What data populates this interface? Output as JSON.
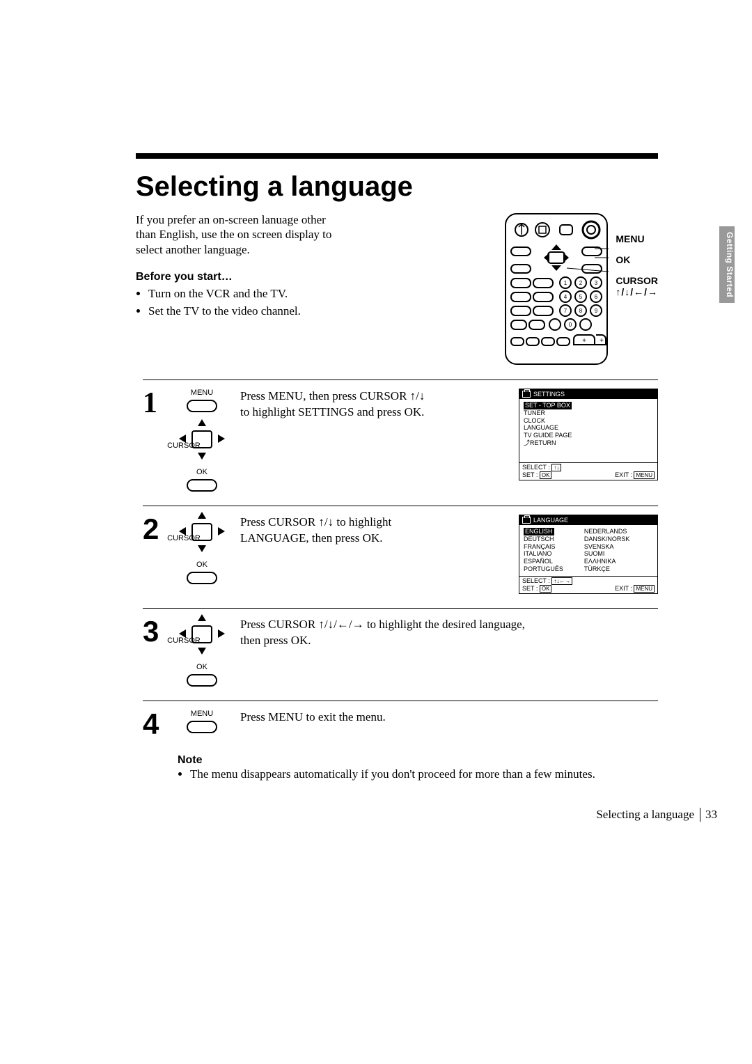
{
  "title": "Selecting a language",
  "intro_paragraph": "If you prefer an on-screen lanuage other than English, use the on screen display to select another language.",
  "before_you_start_heading": "Before you start…",
  "before_you_start_items": [
    "Turn on the VCR and the TV.",
    "Set the TV to the video channel."
  ],
  "side_tab": "Getting Started",
  "remote_labels": {
    "menu": "MENU",
    "ok": "OK",
    "cursor": "CURSOR",
    "arrows": "↑/↓/←/→"
  },
  "btn_labels": {
    "menu": "MENU",
    "cursor": "CURSOR",
    "ok": "OK"
  },
  "steps": {
    "s1_num": "1",
    "s1_text": "Press MENU, then press CURSOR ↑/↓ to highlight SETTINGS and press OK.",
    "s2_num": "2",
    "s2_text": "Press CURSOR ↑/↓ to highlight LANGUAGE, then press OK.",
    "s3_num": "3",
    "s3_text": "Press CURSOR ↑/↓/←/→ to highlight the desired language, then press OK.",
    "s4_num": "4",
    "s4_text": "Press MENU to exit the menu."
  },
  "osd_settings": {
    "title": "SETTINGS",
    "items": [
      "SET - TOP BOX",
      "TUNER",
      "CLOCK",
      "LANGUAGE",
      "TV GUIDE PAGE",
      "⤴RETURN"
    ],
    "footer_select": "SELECT",
    "footer_set": "SET",
    "footer_ok": "OK",
    "footer_exit": "EXIT",
    "footer_menu": "MENU"
  },
  "osd_language": {
    "title": "LANGUAGE",
    "left_col": [
      "ENGLISH",
      "DEUTSCH",
      "FRANÇAIS",
      "ITALIANO",
      "ESPAÑOL",
      "PORTUGUÊS"
    ],
    "right_col": [
      "NEDERLANDS",
      "DANSK/NORSK",
      "SVENSKA",
      "SUOMI",
      "ΕΛΛΗΝΙΚΑ",
      "TÜRKÇE"
    ],
    "footer_select": "SELECT",
    "footer_set": "SET",
    "footer_ok": "OK",
    "footer_exit": "EXIT",
    "footer_menu": "MENU"
  },
  "note_heading": "Note",
  "note_items": [
    "The menu disappears automatically if you don't proceed for more than a few minutes."
  ],
  "footer_title": "Selecting a language",
  "page_number": "33"
}
